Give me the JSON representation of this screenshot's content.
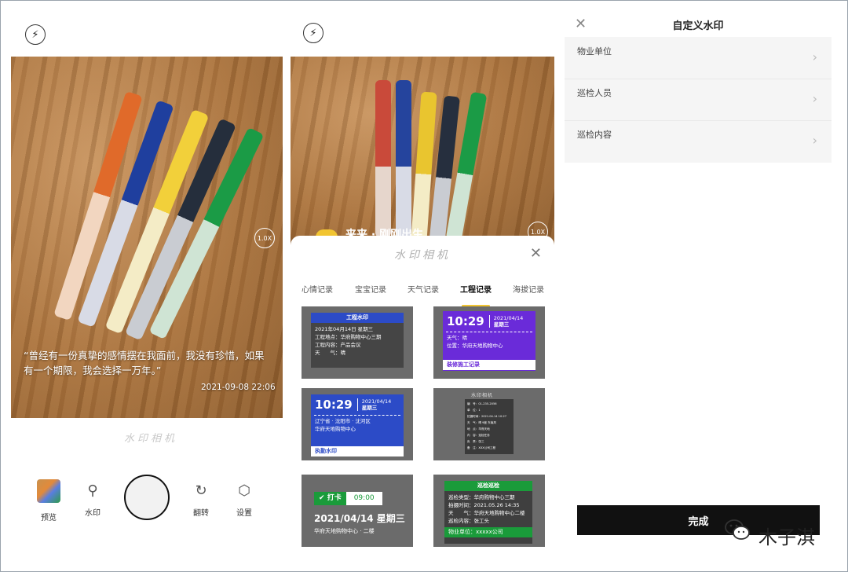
{
  "panel1": {
    "quote": "“曾经有一份真挚的感情摆在我面前，我没有珍惜，如果有一个期限，我会选择一万年。”",
    "timestamp": "2021-09-08 22:06",
    "zoom": "1.0X",
    "brand": "水印相机",
    "toolbar": {
      "preview_label": "预览",
      "watermark_label": "水印",
      "flip_label": "翻转",
      "settings_label": "设置"
    }
  },
  "panel2": {
    "zoom": "1.0X",
    "caption_peek": "来来 · 刚刚出生",
    "sheet_title": "水印相机",
    "categories": [
      "心情记录",
      "宝宝记录",
      "天气记录",
      "工程记录",
      "海拔记录"
    ],
    "active_category": "工程记录",
    "cards": {
      "c1": {
        "header": "工程水印",
        "date": "2021年04月14日 星期三",
        "loc": "工程地点：华府购物中心三期",
        "content": "工程内容：产品会议",
        "weather": "天　　气：晴"
      },
      "c2": {
        "time": "10:29",
        "date": "2021/04/14",
        "weekday": "星期三",
        "weather": "天气：晴",
        "loc": "位置：华府天地购物中心",
        "footer": "装修施工记录"
      },
      "c3": {
        "time": "10:29",
        "date": "2021/04/14",
        "weekday": "星期三",
        "region": "辽宁省 · 沈阳市 · 沈河区",
        "place": "华府天地购物中心",
        "footer": "执勤水印"
      },
      "c4": {
        "rows": [
          "编　号：01-235-2056",
          "单　位：1",
          "拍摄时间：2021.04.14 10:27",
          "天　气：晴 9度 东南风",
          "地　点：华府天地",
          "内　容：巡检任务",
          "负　责：张三",
          "备　注：XXX公司工程"
        ],
        "logo": "水印相机"
      },
      "c5": {
        "checkin": "打卡",
        "time": "09:00",
        "date": "2021/04/14 星期三",
        "place": "华府天地购物中心 · 二楼"
      },
      "c6": {
        "header": "巡检巡检",
        "type": "巡检类型：华府购物中心三期",
        "time": "拍摄时间：2021.05.26 14:35",
        "weather": "天　　气：华府天地购物中心二楼",
        "content": "巡检内容：张工头",
        "footer": "物业单位：xxxxx公司"
      }
    }
  },
  "panel3": {
    "title": "自定义水印",
    "rows": [
      "物业单位",
      "巡检人员",
      "巡检内容"
    ],
    "done_label": "完成",
    "account_name": "木子淇"
  },
  "colors": {
    "blue": "#2c4bc7",
    "purple": "#6a2bd9",
    "green": "#1a9b3a",
    "accent": "#f2c531"
  }
}
